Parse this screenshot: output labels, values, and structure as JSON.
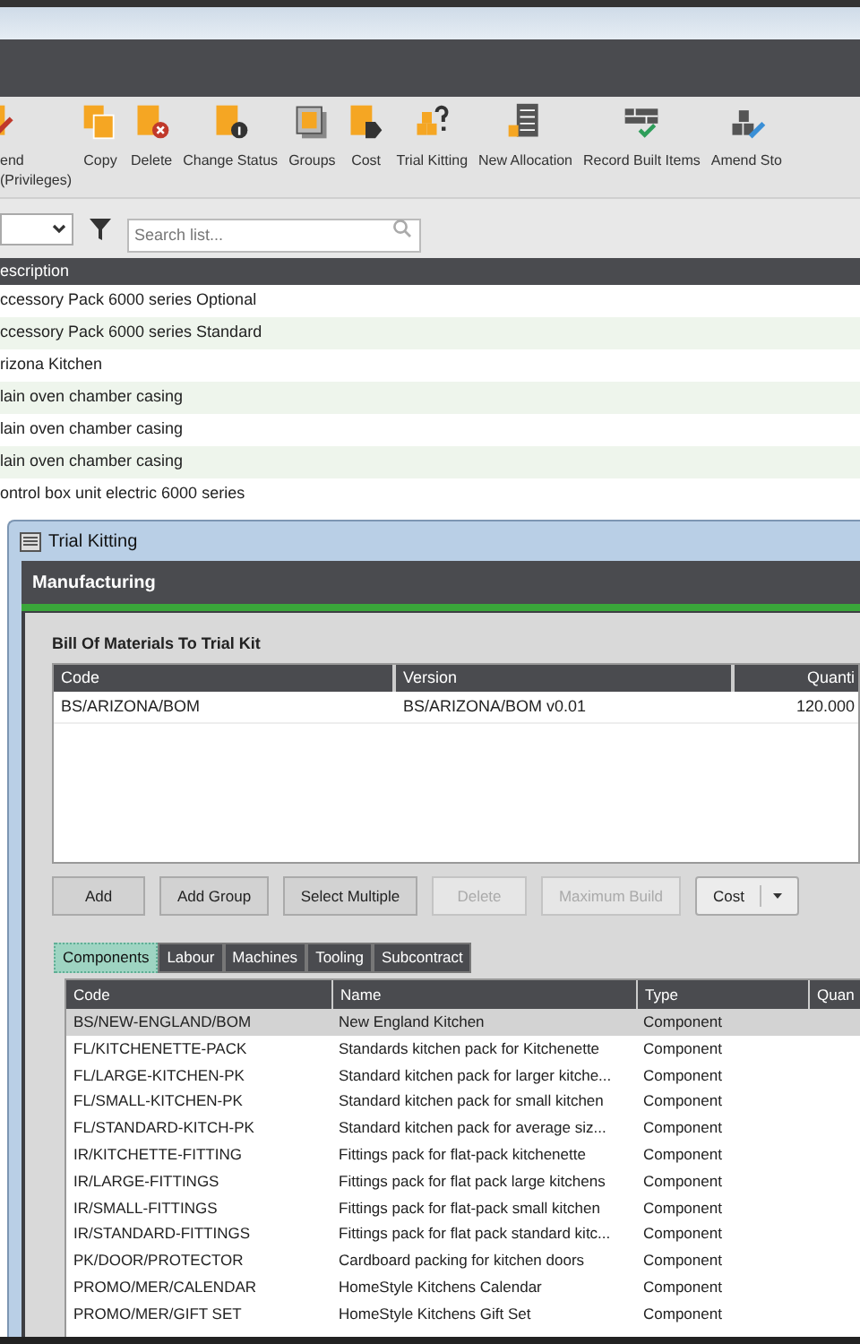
{
  "toolbar": [
    {
      "label": "end\n(Privileges)",
      "kind": "amend-privileges"
    },
    {
      "label": "Copy",
      "kind": "copy"
    },
    {
      "label": "Delete",
      "kind": "delete"
    },
    {
      "label": "Change Status",
      "kind": "status"
    },
    {
      "label": "Groups",
      "kind": "groups"
    },
    {
      "label": "Cost",
      "kind": "cost"
    },
    {
      "label": "Trial Kitting",
      "kind": "kitting"
    },
    {
      "label": "New Allocation",
      "kind": "allocation"
    },
    {
      "label": "Record Built Items",
      "kind": "record"
    },
    {
      "label": "Amend Sto",
      "kind": "amend-stock"
    }
  ],
  "filter": {
    "search_placeholder": "Search list..."
  },
  "list": {
    "columns": [
      "escription"
    ],
    "rows": [
      "ccessory Pack 6000 series Optional",
      "ccessory Pack 6000 series Standard",
      "rizona Kitchen",
      "lain oven chamber casing",
      "lain oven chamber casing",
      "lain oven chamber casing",
      "ontrol box unit electric 6000 series"
    ]
  },
  "dialog": {
    "title": "Trial Kitting",
    "header": "Manufacturing",
    "section_title": "Bill Of Materials To Trial Kit",
    "bom_table": {
      "columns": [
        "Code",
        "Version",
        "Quanti"
      ],
      "rows": [
        [
          "BS/ARIZONA/BOM",
          "BS/ARIZONA/BOM v0.01",
          "120.000"
        ]
      ]
    },
    "buttons": [
      {
        "label": "Add",
        "disabled": false,
        "kind": "plain"
      },
      {
        "label": "Add Group",
        "disabled": false,
        "kind": "plain"
      },
      {
        "label": "Select Multiple",
        "disabled": false,
        "kind": "plain"
      },
      {
        "label": "Delete",
        "disabled": true,
        "kind": "plain"
      },
      {
        "label": "Maximum Build",
        "disabled": true,
        "kind": "plain"
      },
      {
        "label": "Cost",
        "disabled": false,
        "kind": "split"
      }
    ],
    "tabs": [
      {
        "label": "Components",
        "selected": true
      },
      {
        "label": "Labour",
        "selected": false
      },
      {
        "label": "Machines",
        "selected": false
      },
      {
        "label": "Tooling",
        "selected": false
      },
      {
        "label": "Subcontract",
        "selected": false
      }
    ],
    "components": {
      "columns": [
        "Code",
        "Name",
        "Type",
        "Quan"
      ],
      "rows": [
        {
          "cells": [
            "BS/NEW-ENGLAND/BOM",
            "New England Kitchen",
            "Component"
          ],
          "selected": true
        },
        {
          "cells": [
            "FL/KITCHENETTE-PACK",
            "Standards kitchen pack for Kitchenette",
            "Component"
          ],
          "selected": false
        },
        {
          "cells": [
            "FL/LARGE-KITCHEN-PK",
            "Standard kitchen pack for larger kitche...",
            "Component"
          ],
          "selected": false
        },
        {
          "cells": [
            "FL/SMALL-KITCHEN-PK",
            "Standard kitchen pack for small kitchen",
            "Component"
          ],
          "selected": false
        },
        {
          "cells": [
            "FL/STANDARD-KITCH-PK",
            "Standard kitchen pack for average siz...",
            "Component"
          ],
          "selected": false
        },
        {
          "cells": [
            "IR/KITCHETTE-FITTING",
            "Fittings pack for flat-pack kitchenette",
            "Component"
          ],
          "selected": false
        },
        {
          "cells": [
            "IR/LARGE-FITTINGS",
            "Fittings pack for flat pack large kitchens",
            "Component"
          ],
          "selected": false
        },
        {
          "cells": [
            "IR/SMALL-FITTINGS",
            "Fittings pack for flat-pack small kitchen",
            "Component"
          ],
          "selected": false
        },
        {
          "cells": [
            "IR/STANDARD-FITTINGS",
            "Fittings pack for flat pack standard kitc...",
            "Component"
          ],
          "selected": false
        },
        {
          "cells": [
            "PK/DOOR/PROTECTOR",
            "Cardboard packing for kitchen doors",
            "Component"
          ],
          "selected": false
        },
        {
          "cells": [
            "PROMO/MER/CALENDAR",
            "HomeStyle Kitchens Calendar",
            "Component"
          ],
          "selected": false
        },
        {
          "cells": [
            "PROMO/MER/GIFT SET",
            "HomeStyle Kitchens Gift Set",
            "Component"
          ],
          "selected": false
        }
      ]
    }
  }
}
